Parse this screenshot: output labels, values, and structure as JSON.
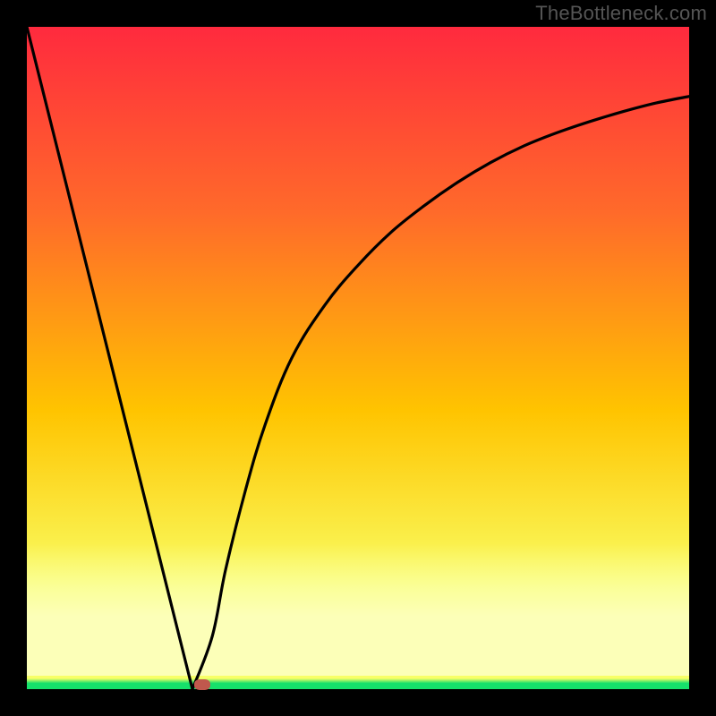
{
  "watermark": "TheBottleneck.com",
  "colors": {
    "bg": "#000000",
    "gradient_top": "#ff2a3e",
    "gradient_mid": "#ffc400",
    "gradient_low": "#f8ff66",
    "glow": "#fcffb8",
    "green": "#16e06b",
    "curve": "#000000",
    "marker": "#c0584d"
  },
  "chart_data": {
    "type": "line",
    "title": "",
    "xlabel": "",
    "ylabel": "",
    "xlim": [
      0,
      100
    ],
    "ylim": [
      0,
      100
    ],
    "grid": false,
    "series": [
      {
        "name": "left-descent",
        "x": [
          0,
          25
        ],
        "values": [
          100,
          0
        ]
      },
      {
        "name": "right-curve",
        "x": [
          25,
          28,
          30,
          33,
          36,
          40,
          45,
          50,
          55,
          60,
          65,
          70,
          75,
          80,
          85,
          90,
          95,
          100
        ],
        "values": [
          0,
          8,
          18,
          30,
          40,
          50,
          58,
          64,
          69,
          73,
          76.5,
          79.5,
          82,
          84,
          85.7,
          87.2,
          88.5,
          89.5
        ]
      }
    ],
    "marker": {
      "x": 26.5,
      "y": 0.7
    },
    "legend": false
  }
}
